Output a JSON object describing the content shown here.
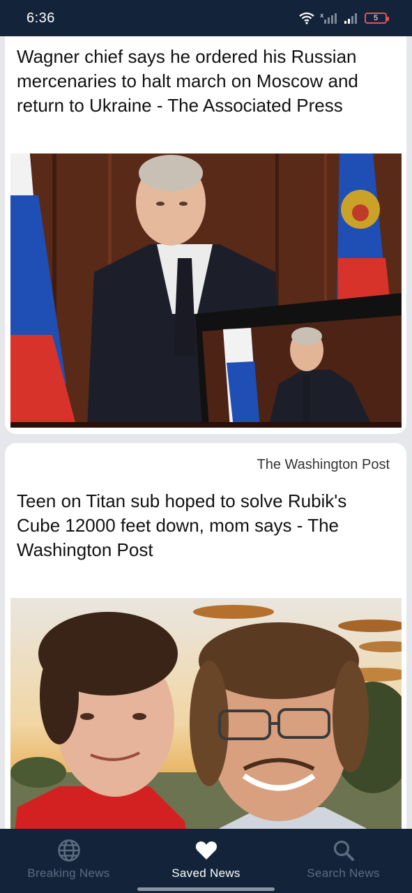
{
  "status_bar": {
    "time": "6:36",
    "battery_level": "5",
    "icons": [
      "wifi-icon",
      "signal-x-icon",
      "signal-icon",
      "battery-icon"
    ]
  },
  "articles": [
    {
      "source": "",
      "title": "Wagner chief says he ordered his Russian mercenaries to halt march on Moscow and return to Ukraine - The Associated Press",
      "image": "photo-putin-address"
    },
    {
      "source": "The Washington Post",
      "title": "Teen on Titan sub hoped to solve Rubik's Cube 12000 feet down, mom says - The Washington Post",
      "image": "photo-father-son-selfie"
    }
  ],
  "bottom_nav": {
    "items": [
      {
        "label": "Breaking News",
        "icon": "globe-icon",
        "active": false
      },
      {
        "label": "Saved News",
        "icon": "heart-icon",
        "active": true
      },
      {
        "label": "Search News",
        "icon": "search-icon",
        "active": false
      }
    ]
  },
  "colors": {
    "nav_background": "#13243a",
    "page_background": "#e6e7ea",
    "card_background": "#ffffff",
    "inactive_nav": "#5d6b7f",
    "active_nav": "#ffffff"
  }
}
